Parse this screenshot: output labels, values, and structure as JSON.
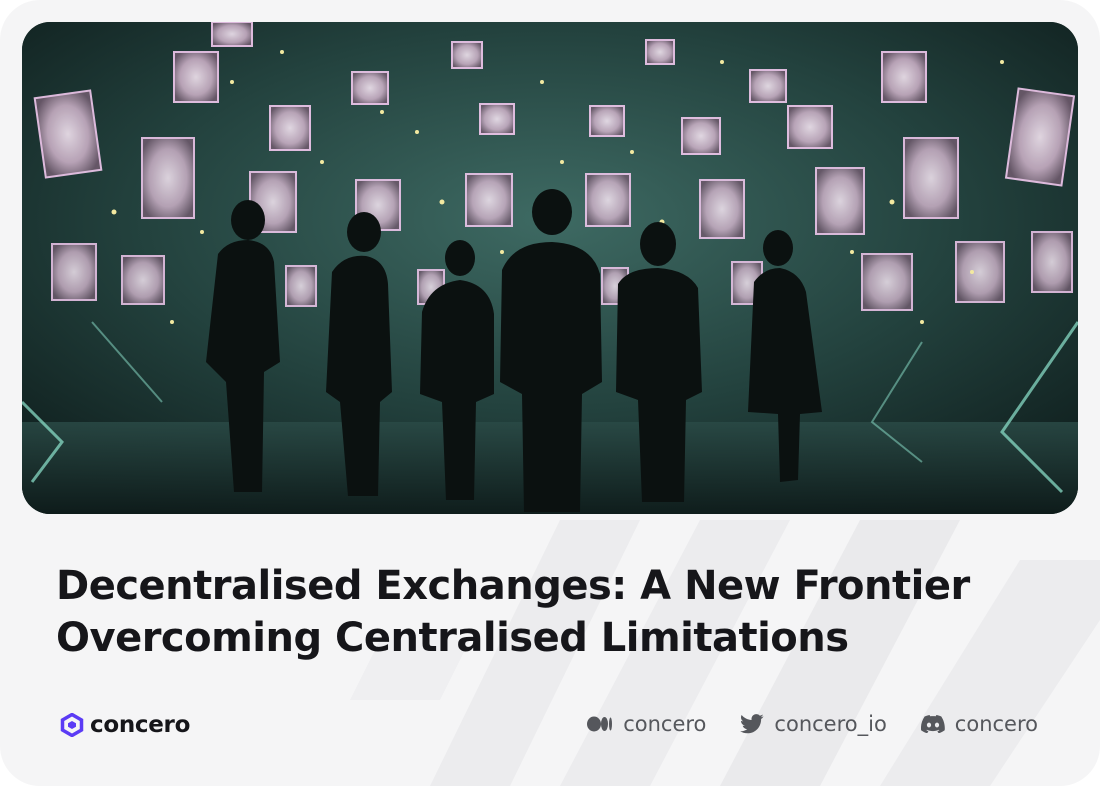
{
  "card": {
    "background_color": "#f5f5f6",
    "title_lines": [
      "Decentralised Exchanges: A New Frontier",
      "Overcoming Centralised Limitations"
    ],
    "title_color": "#16161a"
  },
  "hero_image": {
    "icon": "silhouettes-in-digital-gallery-illustration",
    "accent_color": "#7fd8c0"
  },
  "brand": {
    "logo_icon": "concero-hexagon-logo-icon",
    "name": "concero",
    "logo_color": "#5b3bf5"
  },
  "socials": [
    {
      "icon": "medium-icon",
      "label": "concero"
    },
    {
      "icon": "twitter-icon",
      "label": "concero_io"
    },
    {
      "icon": "discord-icon",
      "label": "concero"
    }
  ]
}
